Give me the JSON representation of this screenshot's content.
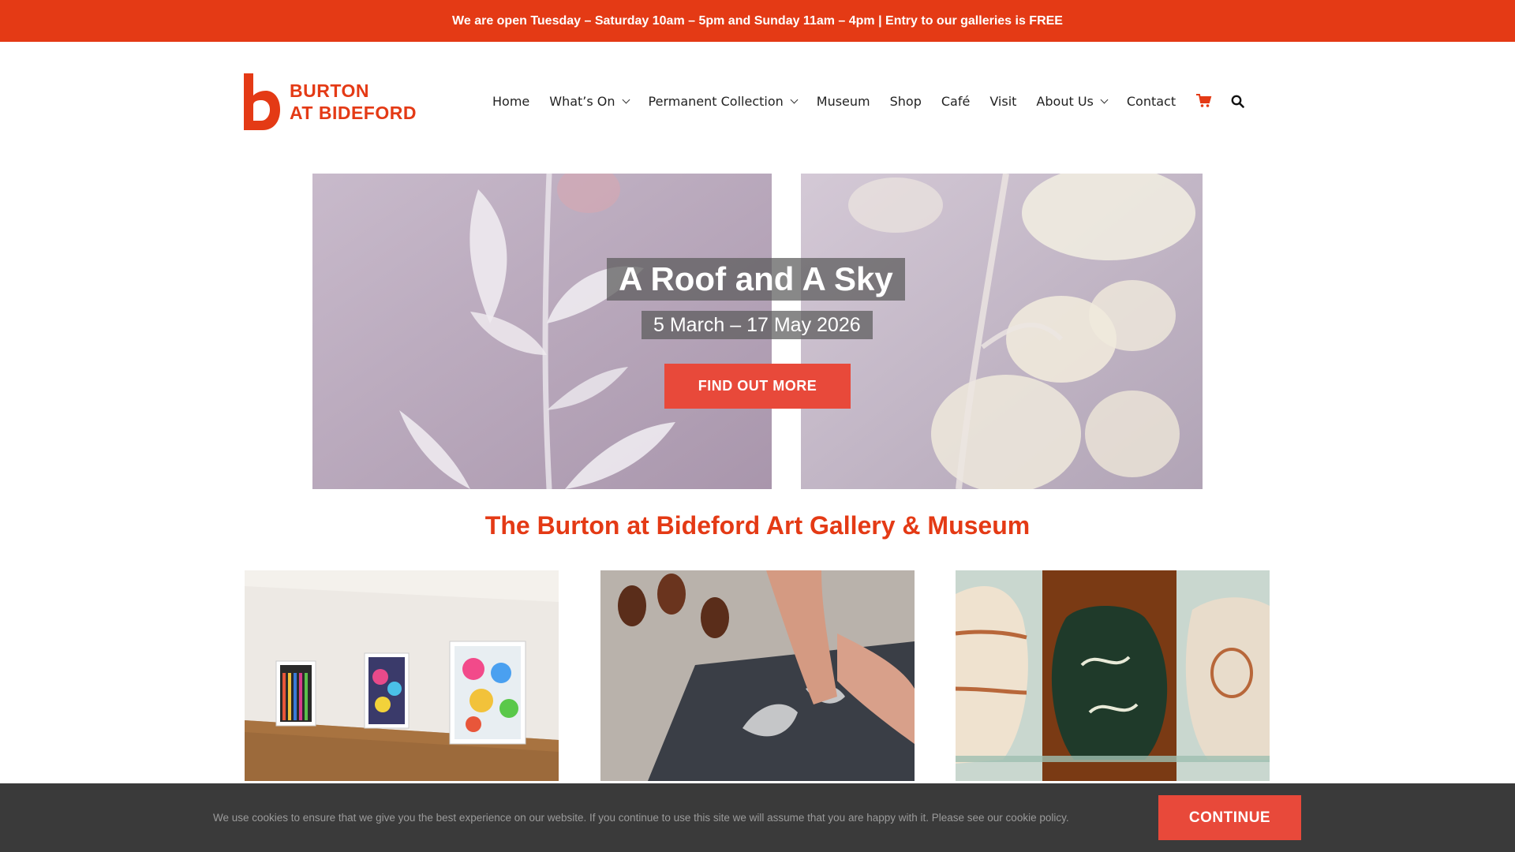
{
  "announcement": "We are open Tuesday – Saturday 10am – 5pm and Sunday 11am – 4pm | Entry to our galleries is FREE",
  "logo": {
    "line1": "BURTON",
    "line2": "AT BIDEFORD"
  },
  "nav": {
    "home": "Home",
    "whats_on": "What’s On",
    "permanent_collection": "Permanent Collection",
    "museum": "Museum",
    "shop": "Shop",
    "cafe": "Café",
    "visit": "Visit",
    "about_us": "About Us",
    "contact": "Contact",
    "cart_icon": "cart-icon",
    "search_icon": "search-icon"
  },
  "hero": {
    "title": "A Roof and A Sky",
    "dates": "5 March – 17 May 2026",
    "button": "FIND OUT MORE"
  },
  "section_heading": "The Burton at Bideford Art Gallery & Museum",
  "cookie": {
    "text": "We use cookies to ensure that we give you the best experience on our website. If you continue to use this site we will assume that you are happy with it. Please see our cookie policy.",
    "button": "CONTINUE"
  },
  "colors": {
    "brand": "#e43a15",
    "button": "#e8493a",
    "cookie_bg": "#3a3a3a"
  }
}
